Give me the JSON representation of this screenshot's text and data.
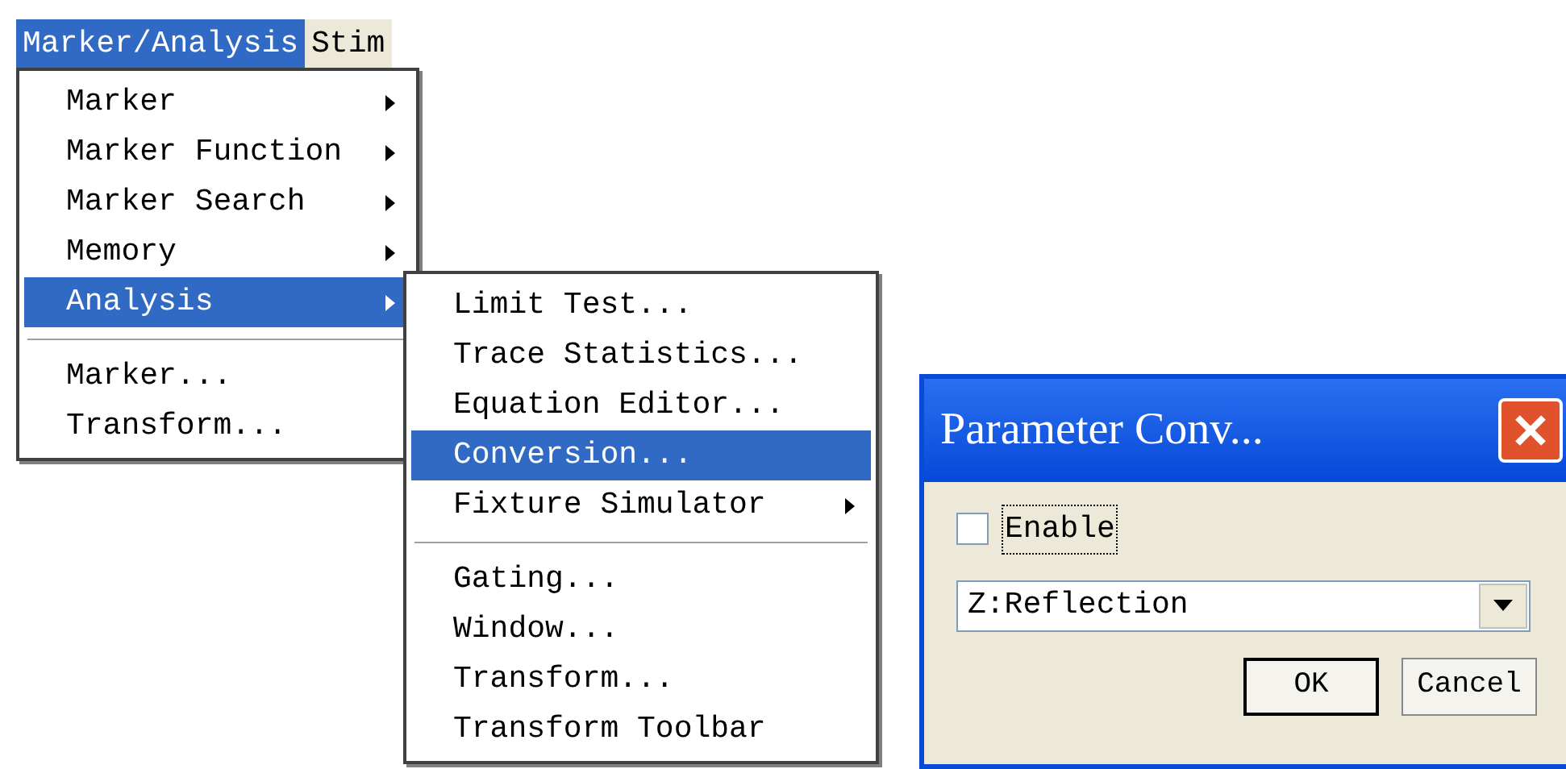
{
  "menu_bar": [
    {
      "label": "Marker/Analysis",
      "selected": true
    },
    {
      "label": "Stim",
      "selected": false
    }
  ],
  "menu": [
    {
      "kind": "item",
      "label": "Marker",
      "submenu": true,
      "selected": false
    },
    {
      "kind": "item",
      "label": "Marker Function",
      "submenu": true,
      "selected": false
    },
    {
      "kind": "item",
      "label": "Marker Search",
      "submenu": true,
      "selected": false
    },
    {
      "kind": "item",
      "label": "Memory",
      "submenu": true,
      "selected": false
    },
    {
      "kind": "item",
      "label": "Analysis",
      "submenu": true,
      "selected": true
    },
    {
      "kind": "separator"
    },
    {
      "kind": "item",
      "label": "Marker...",
      "submenu": false,
      "selected": false
    },
    {
      "kind": "item",
      "label": "Transform...",
      "submenu": false,
      "selected": false
    }
  ],
  "submenu": [
    {
      "kind": "item",
      "label": "Limit Test...",
      "submenu": false,
      "selected": false
    },
    {
      "kind": "item",
      "label": "Trace Statistics...",
      "submenu": false,
      "selected": false
    },
    {
      "kind": "item",
      "label": "Equation Editor...",
      "submenu": false,
      "selected": false
    },
    {
      "kind": "item",
      "label": "Conversion...",
      "submenu": false,
      "selected": true
    },
    {
      "kind": "item",
      "label": "Fixture Simulator",
      "submenu": true,
      "selected": false
    },
    {
      "kind": "separator"
    },
    {
      "kind": "item",
      "label": "Gating...",
      "submenu": false,
      "selected": false
    },
    {
      "kind": "item",
      "label": "Window...",
      "submenu": false,
      "selected": false
    },
    {
      "kind": "item",
      "label": "Transform...",
      "submenu": false,
      "selected": false
    },
    {
      "kind": "item",
      "label": "Transform Toolbar",
      "submenu": false,
      "selected": false
    }
  ],
  "dialog": {
    "title": "Parameter Conv...",
    "enable": {
      "label": "Enable",
      "checked": false
    },
    "dropdown": {
      "value": "Z:Reflection"
    },
    "buttons": [
      "OK",
      "Cancel"
    ]
  }
}
